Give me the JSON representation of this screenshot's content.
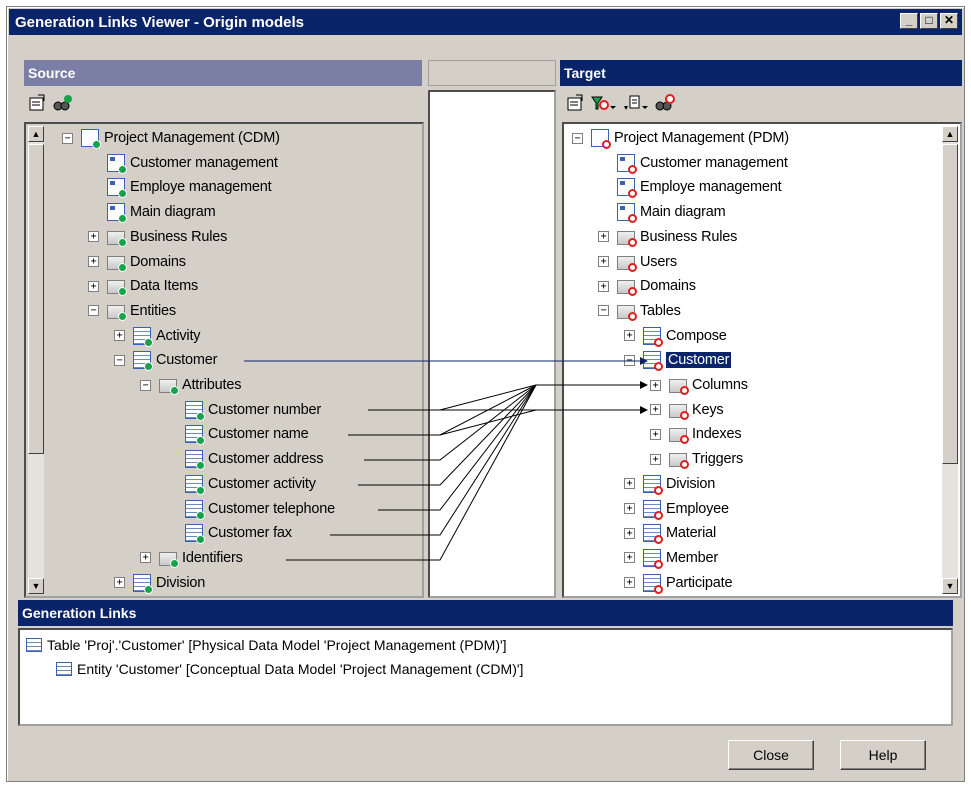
{
  "window": {
    "title": "Generation Links Viewer - Origin models"
  },
  "panels": {
    "source_label": "Source",
    "target_label": "Target"
  },
  "source_tree": [
    {
      "label": "Project Management (CDM)",
      "level": 0,
      "expander": "−",
      "icon": "cdm-model-icon"
    },
    {
      "label": "Customer management",
      "level": 1,
      "icon": "diagram-icon"
    },
    {
      "label": "Employe management",
      "level": 1,
      "icon": "diagram-icon"
    },
    {
      "label": "Main diagram",
      "level": 1,
      "icon": "diagram-icon"
    },
    {
      "label": "Business Rules",
      "level": 1,
      "expander": "+",
      "icon": "folder-icon"
    },
    {
      "label": "Domains",
      "level": 1,
      "expander": "+",
      "icon": "folder-icon"
    },
    {
      "label": "Data Items",
      "level": 1,
      "expander": "+",
      "icon": "folder-icon"
    },
    {
      "label": "Entities",
      "level": 1,
      "expander": "−",
      "icon": "folder-icon"
    },
    {
      "label": "Activity",
      "level": 2,
      "expander": "+",
      "icon": "entity-icon"
    },
    {
      "label": "Customer",
      "level": 2,
      "expander": "−",
      "icon": "entity-icon"
    },
    {
      "label": "Attributes",
      "level": 3,
      "expander": "−",
      "icon": "folder-icon"
    },
    {
      "label": "Customer number",
      "level": 4,
      "icon": "attribute-icon"
    },
    {
      "label": "Customer name",
      "level": 4,
      "icon": "attribute-icon"
    },
    {
      "label": "Customer address",
      "level": 4,
      "icon": "attribute-icon"
    },
    {
      "label": "Customer activity",
      "level": 4,
      "icon": "attribute-icon"
    },
    {
      "label": "Customer telephone",
      "level": 4,
      "icon": "attribute-icon"
    },
    {
      "label": "Customer fax",
      "level": 4,
      "icon": "attribute-icon"
    },
    {
      "label": "Identifiers",
      "level": 3,
      "expander": "+",
      "icon": "folder-icon"
    },
    {
      "label": "Division",
      "level": 2,
      "expander": "+",
      "icon": "entity-icon"
    }
  ],
  "target_tree": [
    {
      "label": "Project Management (PDM)",
      "level": 0,
      "expander": "−",
      "icon": "pdm-model-icon"
    },
    {
      "label": "Customer management",
      "level": 1,
      "icon": "diagram-icon"
    },
    {
      "label": "Employe management",
      "level": 1,
      "icon": "diagram-icon"
    },
    {
      "label": "Main diagram",
      "level": 1,
      "icon": "diagram-icon"
    },
    {
      "label": "Business Rules",
      "level": 1,
      "expander": "+",
      "icon": "folder-icon"
    },
    {
      "label": "Users",
      "level": 1,
      "expander": "+",
      "icon": "folder-icon"
    },
    {
      "label": "Domains",
      "level": 1,
      "expander": "+",
      "icon": "folder-icon"
    },
    {
      "label": "Tables",
      "level": 1,
      "expander": "−",
      "icon": "folder-icon"
    },
    {
      "label": "Compose",
      "level": 2,
      "expander": "+",
      "icon": "table-icon"
    },
    {
      "label": "Customer",
      "level": 2,
      "expander": "−",
      "icon": "table-icon",
      "selected": true
    },
    {
      "label": "Columns",
      "level": 3,
      "expander": "+",
      "icon": "folder-icon"
    },
    {
      "label": "Keys",
      "level": 3,
      "expander": "+",
      "icon": "folder-icon"
    },
    {
      "label": "Indexes",
      "level": 3,
      "expander": "+",
      "icon": "folder-icon"
    },
    {
      "label": "Triggers",
      "level": 3,
      "expander": "+",
      "icon": "folder-icon"
    },
    {
      "label": "Division",
      "level": 2,
      "expander": "+",
      "icon": "table-icon"
    },
    {
      "label": "Employee",
      "level": 2,
      "expander": "+",
      "icon": "table-icon"
    },
    {
      "label": "Material",
      "level": 2,
      "expander": "+",
      "icon": "table-icon"
    },
    {
      "label": "Member",
      "level": 2,
      "expander": "+",
      "icon": "table-icon"
    },
    {
      "label": "Participate",
      "level": 2,
      "expander": "+",
      "icon": "table-icon"
    }
  ],
  "generation_links": {
    "label": "Generation Links",
    "items": [
      "Table 'Proj'.'Customer' [Physical Data Model 'Project Management (PDM)']",
      "Entity 'Customer' [Conceptual Data Model 'Project Management (CDM)']"
    ]
  },
  "buttons": {
    "close": "Close",
    "help": "Help"
  },
  "colors": {
    "title_bar": "#0a246a",
    "source_header": "#7b7fa6",
    "dialog_bg": "#d4d0c8",
    "selection": "#0a246a"
  }
}
